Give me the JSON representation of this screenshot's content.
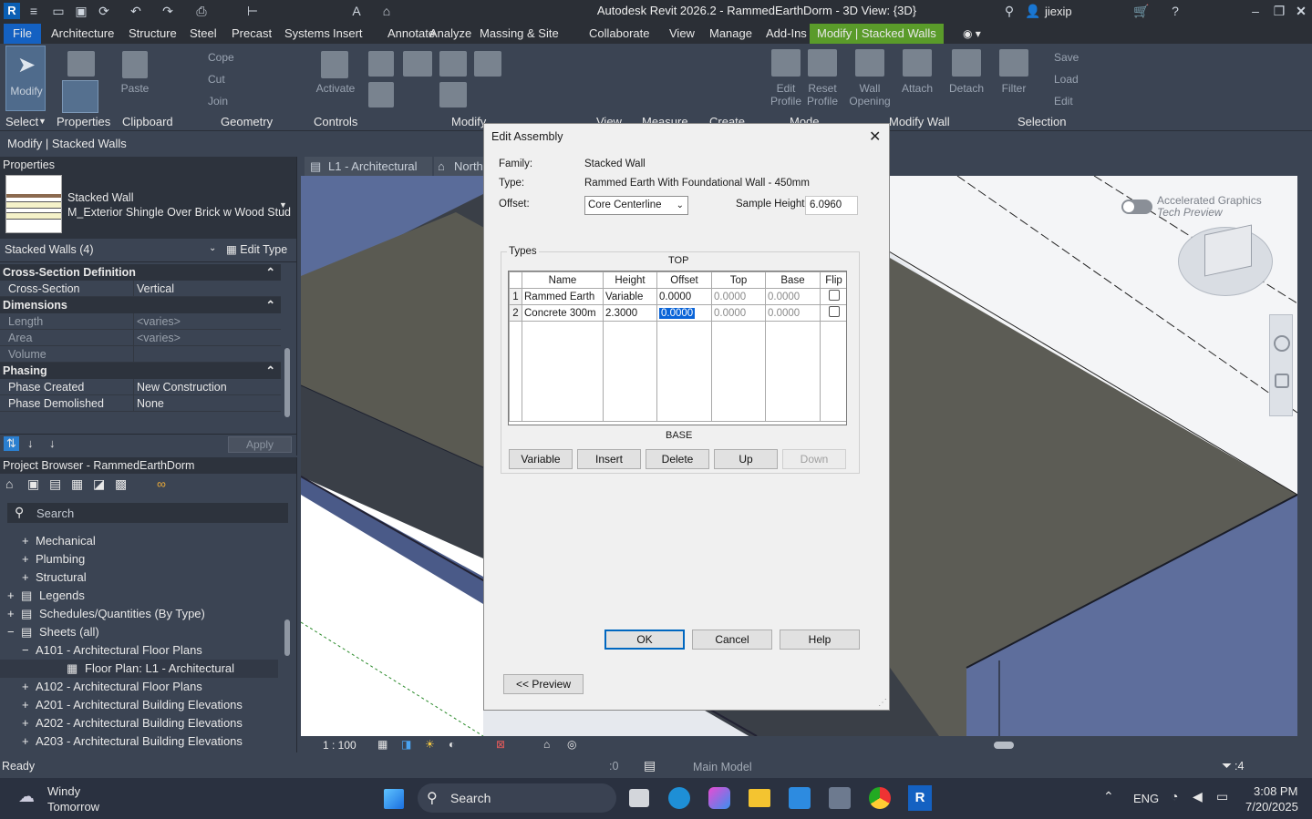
{
  "window": {
    "title": "Autodesk Revit 2026.2 - RammedEarthDorm - 3D View: {3D}",
    "user": "jiexip"
  },
  "menu": {
    "tabs": [
      "File",
      "Architecture",
      "Structure",
      "Steel",
      "Precast",
      "Systems",
      "Insert",
      "Annotate",
      "Analyze",
      "Massing & Site",
      "Collaborate",
      "View",
      "Manage",
      "Add-Ins",
      "Modify | Stacked Walls"
    ]
  },
  "ribbon": {
    "panels": [
      "Select",
      "Properties",
      "Clipboard",
      "Geometry",
      "Controls",
      "Modify",
      "View",
      "Measure",
      "Create",
      "Mode",
      "Modify Wall",
      "Selection"
    ],
    "buttons": {
      "modify": "Modify",
      "paste": "Paste",
      "cope": "Cope",
      "cut": "Cut",
      "join": "Join",
      "activate": "Activate",
      "edit_profile": "Edit Profile",
      "reset_profile": "Reset Profile",
      "wall_opening": "Wall Opening",
      "attach": "Attach",
      "detach": "Detach",
      "filter": "Filter",
      "save": "Save",
      "load": "Load",
      "edit": "Edit"
    }
  },
  "options_bar": {
    "label": "Modify | Stacked Walls"
  },
  "properties": {
    "title": "Properties",
    "type_family": "Stacked Wall",
    "type_name": "M_Exterior Shingle Over Brick w Wood Stud",
    "selector": "Stacked Walls (4)",
    "edit_type": "Edit Type",
    "sections": [
      {
        "name": "Cross-Section Definition",
        "rows": [
          {
            "k": "Cross-Section",
            "v": "Vertical",
            "grey": false
          }
        ]
      },
      {
        "name": "Dimensions",
        "rows": [
          {
            "k": "Length",
            "v": "<varies>",
            "grey": true
          },
          {
            "k": "Area",
            "v": "<varies>",
            "grey": true
          },
          {
            "k": "Volume",
            "v": "",
            "grey": true
          }
        ]
      },
      {
        "name": "Phasing",
        "rows": [
          {
            "k": "Phase Created",
            "v": "New Construction",
            "grey": false
          },
          {
            "k": "Phase Demolished",
            "v": "None",
            "grey": false
          }
        ]
      }
    ],
    "apply": "Apply"
  },
  "project_browser": {
    "title": "Project Browser - RammedEarthDorm",
    "search_placeholder": "Search",
    "items": [
      {
        "label": "Mechanical",
        "indent": 1,
        "exp": "+"
      },
      {
        "label": "Plumbing",
        "indent": 1,
        "exp": "+"
      },
      {
        "label": "Structural",
        "indent": 1,
        "exp": "+"
      },
      {
        "label": "Legends",
        "indent": 0,
        "exp": "+"
      },
      {
        "label": "Schedules/Quantities (By Type)",
        "indent": 0,
        "exp": "+"
      },
      {
        "label": "Sheets (all)",
        "indent": 0,
        "exp": "−"
      },
      {
        "label": "A101 - Architectural Floor Plans",
        "indent": 1,
        "exp": "−"
      },
      {
        "label": "Floor Plan: L1 - Architectural",
        "indent": 2,
        "exp": ""
      },
      {
        "label": "A102 - Architectural Floor Plans",
        "indent": 1,
        "exp": "+"
      },
      {
        "label": "A201 - Architectural Building Elevations",
        "indent": 1,
        "exp": "+"
      },
      {
        "label": "A202 - Architectural Building Elevations",
        "indent": 1,
        "exp": "+"
      },
      {
        "label": "A203 - Architectural Building Elevations",
        "indent": 1,
        "exp": "+"
      }
    ]
  },
  "view_tabs": [
    "L1 - Architectural",
    "North"
  ],
  "viewport": {
    "accel_line1": "Accelerated Graphics",
    "accel_line2": "Tech Preview",
    "scale": "1 : 100"
  },
  "status": {
    "left": "Ready",
    "workset_count": ":0",
    "model": "Main Model",
    "filter_count": ":4"
  },
  "dialog": {
    "title": "Edit Assembly",
    "family_label": "Family:",
    "family_value": "Stacked Wall",
    "type_label": "Type:",
    "type_value": "Rammed Earth With Foundational Wall - 450mm",
    "offset_label": "Offset:",
    "offset_value": "Core Centerline",
    "sample_label": "Sample Height:",
    "sample_value": "6.0960",
    "types_group": "Types",
    "top": "TOP",
    "base": "BASE",
    "columns": [
      "Name",
      "Height",
      "Offset",
      "Top",
      "Base",
      "Flip"
    ],
    "rows": [
      {
        "num": "1",
        "name": "Rammed Earth",
        "height": "Variable",
        "offset": "0.0000",
        "top": "0.0000",
        "base": "0.0000"
      },
      {
        "num": "2",
        "name": "Concrete 300m",
        "height": "2.3000",
        "offset": "0.0000",
        "top": "0.0000",
        "base": "0.0000"
      }
    ],
    "buttons": {
      "variable": "Variable",
      "insert": "Insert",
      "delete": "Delete",
      "up": "Up",
      "down": "Down",
      "ok": "OK",
      "cancel": "Cancel",
      "help": "Help",
      "preview": "<< Preview"
    }
  },
  "taskbar": {
    "weather1": "Windy",
    "weather2": "Tomorrow",
    "search": "Search",
    "lang": "ENG",
    "time": "3:08 PM",
    "date": "7/20/2025"
  }
}
